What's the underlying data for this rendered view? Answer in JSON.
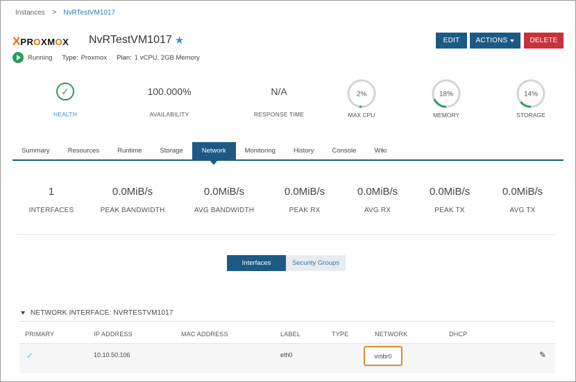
{
  "breadcrumb": {
    "root": "Instances",
    "separator": ">",
    "current": "NvRTestVM1017"
  },
  "header": {
    "logo": {
      "x": "X",
      "text_pre": "PR",
      "text_o1": "O",
      "text_mid": "XM",
      "text_o2": "O",
      "text_post": "X"
    },
    "title": "NvRTestVM1017",
    "favorite_icon": "star-icon",
    "status": "Running",
    "type_label": "Type:",
    "type_value": "Proxmox",
    "plan_label": "Plan:",
    "plan_value": "1 vCPU, 2GB Memory",
    "buttons": {
      "edit": "EDIT",
      "actions": "ACTIONS",
      "delete": "DELETE"
    }
  },
  "summary": {
    "health": {
      "label": "HEALTH",
      "icon": "check-circle-icon"
    },
    "availability": {
      "value": "100.000%",
      "label": "AVAILABILITY"
    },
    "response_time": {
      "value": "N/A",
      "label": "RESPONSE TIME"
    },
    "max_cpu": {
      "value": "2%",
      "label": "MAX CPU",
      "fraction": 0.02
    },
    "memory": {
      "value": "18%",
      "label": "MEMORY",
      "fraction": 0.18
    },
    "storage": {
      "value": "14%",
      "label": "STORAGE",
      "fraction": 0.14
    }
  },
  "tabs": [
    "Summary",
    "Resources",
    "Runtime",
    "Storage",
    "Network",
    "Monitoring",
    "History",
    "Console",
    "Wiki"
  ],
  "active_tab": "Network",
  "network_stats": [
    {
      "value": "1",
      "label": "INTERFACES"
    },
    {
      "value": "0.0MiB/s",
      "label": "PEAK BANDWIDTH"
    },
    {
      "value": "0.0MiB/s",
      "label": "AVG BANDWIDTH"
    },
    {
      "value": "0.0MiB/s",
      "label": "PEAK RX"
    },
    {
      "value": "0.0MiB/s",
      "label": "AVG RX"
    },
    {
      "value": "0.0MiB/s",
      "label": "PEAK TX"
    },
    {
      "value": "0.0MiB/s",
      "label": "AVG TX"
    }
  ],
  "toggle": {
    "interfaces": "Interfaces",
    "security_groups": "Security Groups"
  },
  "interface_section": {
    "title": "NETWORK INTERFACE: NVRTESTVM1017",
    "columns": [
      "PRIMARY",
      "IP ADDRESS",
      "MAC ADDRESS",
      "LABEL",
      "TYPE",
      "NETWORK",
      "DHCP"
    ],
    "row": {
      "primary_icon": "check-icon",
      "ip_address": "10.10.50.106",
      "mac_address": "",
      "label": "eth0",
      "type": "",
      "network": "vmbr0",
      "dhcp": ""
    }
  },
  "colors": {
    "primary": "#1c5a85",
    "danger": "#c8303a",
    "success": "#2a9d5a",
    "highlight": "#e08a2e",
    "logo_accent": "#e57000"
  }
}
